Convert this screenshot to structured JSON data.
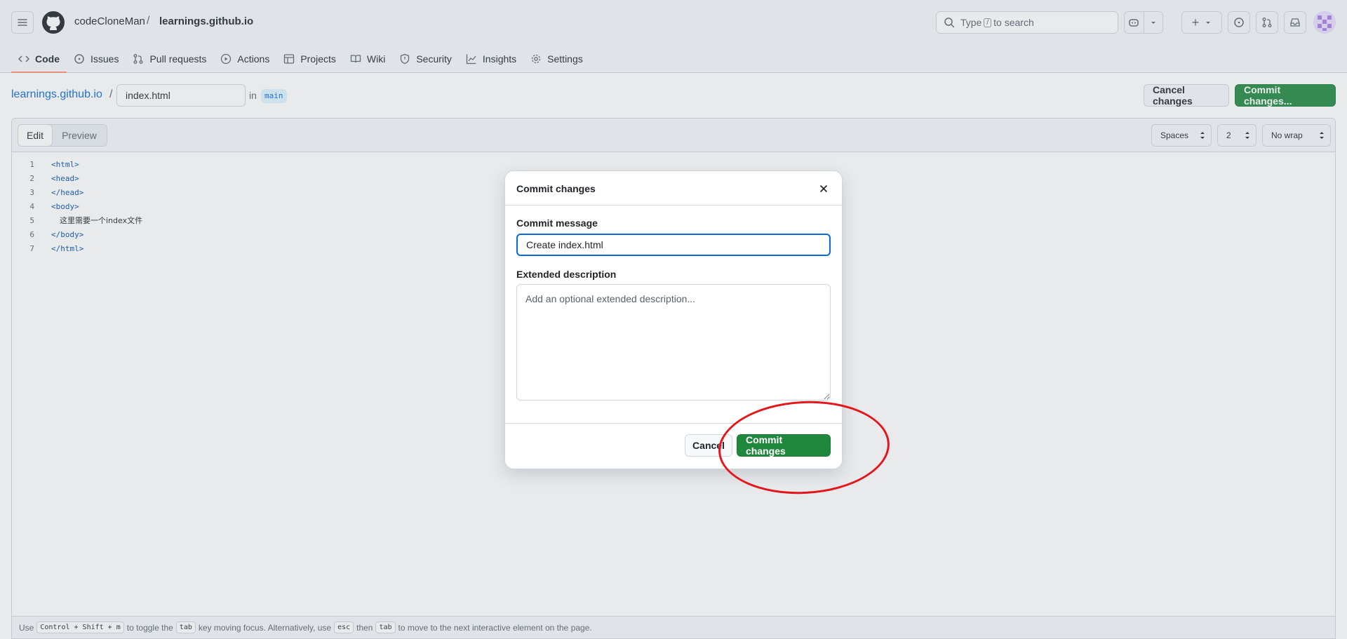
{
  "header": {
    "owner": "codeCloneMan",
    "separator": "/",
    "repo": "learnings.github.io",
    "search": {
      "prefix": "Type",
      "key": "/",
      "suffix": "to search"
    }
  },
  "tabs": [
    {
      "label": "Code",
      "icon": "code-icon"
    },
    {
      "label": "Issues",
      "icon": "issue-icon"
    },
    {
      "label": "Pull requests",
      "icon": "pull-request-icon"
    },
    {
      "label": "Actions",
      "icon": "play-icon"
    },
    {
      "label": "Projects",
      "icon": "table-icon"
    },
    {
      "label": "Wiki",
      "icon": "book-icon"
    },
    {
      "label": "Security",
      "icon": "shield-icon"
    },
    {
      "label": "Insights",
      "icon": "graph-icon"
    },
    {
      "label": "Settings",
      "icon": "gear-icon"
    }
  ],
  "file": {
    "repo_link": "learnings.github.io",
    "slash": "/",
    "filename": "index.html",
    "in_label": "in",
    "branch": "main",
    "cancel_label": "Cancel changes",
    "commit_label": "Commit changes..."
  },
  "editor": {
    "edit_label": "Edit",
    "preview_label": "Preview",
    "indent_mode": "Spaces",
    "indent_size": "2",
    "wrap_mode": "No wrap",
    "lines": [
      {
        "num": "1",
        "text": "<html>"
      },
      {
        "num": "2",
        "text": "<head>"
      },
      {
        "num": "3",
        "text": "</head>"
      },
      {
        "num": "4",
        "text": "<body>"
      },
      {
        "num": "5",
        "text": "这里需要一个index文件"
      },
      {
        "num": "6",
        "text": "</body>"
      },
      {
        "num": "7",
        "text": "</html>"
      }
    ]
  },
  "hint": {
    "use": "Use",
    "keys": "Control + Shift + m",
    "toggle": "to toggle the",
    "tab_key": "tab",
    "moving": "key moving focus. Alternatively, use",
    "esc_key": "esc",
    "then": "then",
    "tab_key2": "tab",
    "rest": "to move to the next interactive element on the page."
  },
  "dialog": {
    "title": "Commit changes",
    "message_label": "Commit message",
    "message_value": "Create index.html",
    "description_label": "Extended description",
    "description_placeholder": "Add an optional extended description...",
    "cancel_label": "Cancel",
    "commit_label": "Commit changes"
  },
  "colors": {
    "primary": "#1f883d",
    "link": "#0969da",
    "annotation": "#e4161b"
  }
}
